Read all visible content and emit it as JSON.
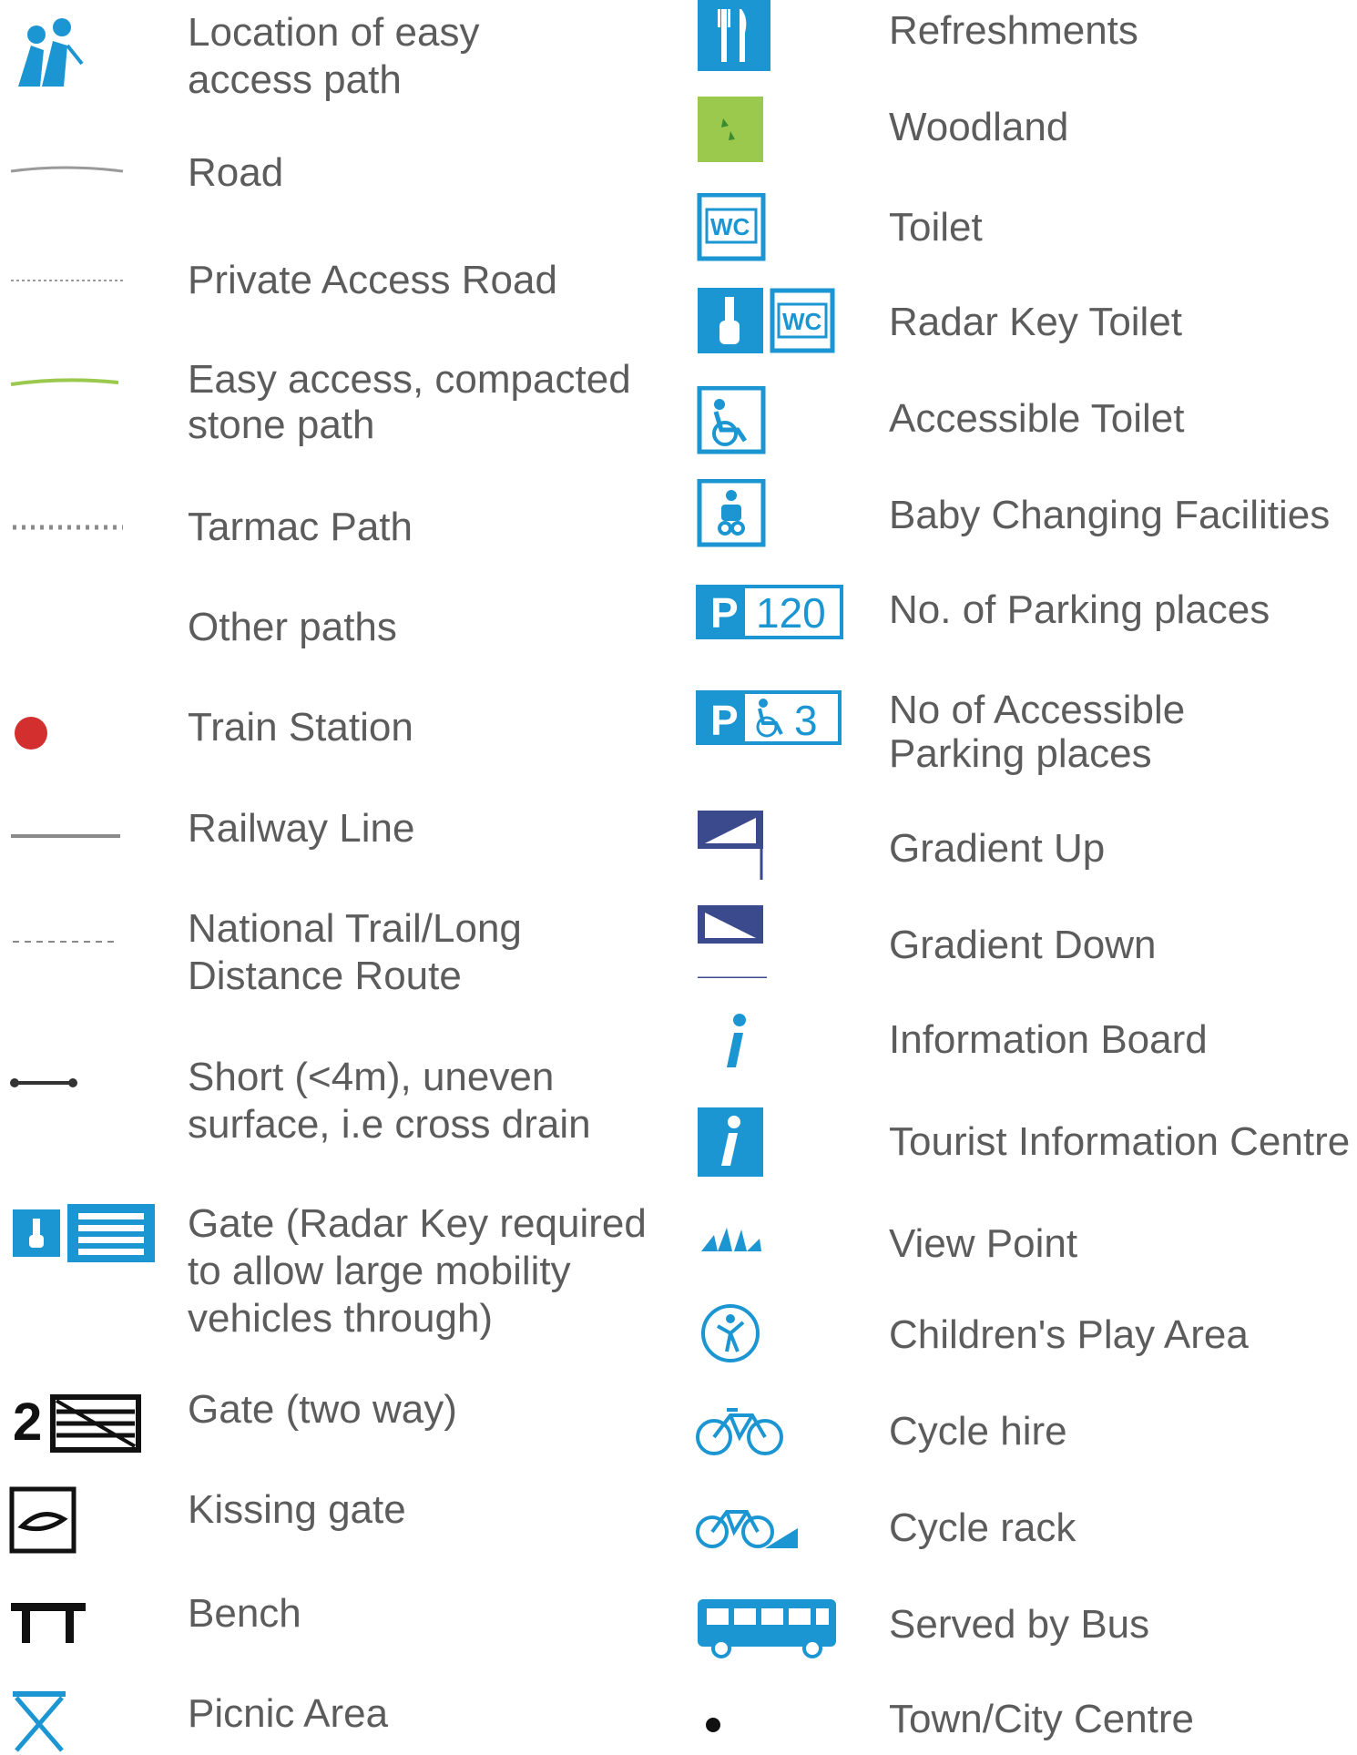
{
  "legend": {
    "left": [
      {
        "icon": "easy-access-walkers-icon",
        "label": "Location of easy\naccess path"
      },
      {
        "icon": "road-line-icon",
        "label": "Road"
      },
      {
        "icon": "private-road-dotted-icon",
        "label": "Private Access Road"
      },
      {
        "icon": "green-path-line-icon",
        "label": "Easy access, compacted\nstone path"
      },
      {
        "icon": "tarmac-path-icon",
        "label": "Tarmac Path"
      },
      {
        "icon": "dashed-path-icon",
        "label": "Other paths"
      },
      {
        "icon": "red-dot-icon",
        "label": "Train Station"
      },
      {
        "icon": "railway-line-icon",
        "label": "Railway Line"
      },
      {
        "icon": "national-trail-dashed-icon",
        "label": "National Trail/Long\nDistance Route"
      },
      {
        "icon": "short-bar-icon",
        "label": "Short (<4m), uneven\nsurface, i.e cross drain"
      },
      {
        "icon": "radar-key-gate-icon",
        "label": "Gate (Radar Key required\nto allow large mobility\nvehicles through)"
      },
      {
        "icon": "two-way-gate-icon",
        "label": "Gate (two way)",
        "number": "2"
      },
      {
        "icon": "kissing-gate-icon",
        "label": "Kissing gate"
      },
      {
        "icon": "bench-icon",
        "label": "Bench"
      },
      {
        "icon": "picnic-table-icon",
        "label": "Picnic Area"
      }
    ],
    "right": [
      {
        "icon": "knife-fork-icon",
        "label": "Refreshments"
      },
      {
        "icon": "woodland-icon",
        "label": "Woodland"
      },
      {
        "icon": "wc-icon",
        "label": "Toilet",
        "badge": "WC"
      },
      {
        "icon": "radar-key-wc-icon",
        "label": "Radar Key Toilet",
        "badge": "WC"
      },
      {
        "icon": "accessible-wc-icon",
        "label": "Accessible Toilet"
      },
      {
        "icon": "baby-changing-icon",
        "label": "Baby Changing Facilities"
      },
      {
        "icon": "parking-icon",
        "label": "No. of Parking places",
        "p": "P",
        "count": "120"
      },
      {
        "icon": "accessible-parking-icon",
        "label": "No of Accessible\nParking places",
        "p": "P",
        "count": "3"
      },
      {
        "icon": "gradient-up-icon",
        "label": "Gradient Up"
      },
      {
        "icon": "gradient-down-icon",
        "label": "Gradient Down"
      },
      {
        "icon": "info-board-icon",
        "label": "Information Board"
      },
      {
        "icon": "tourist-info-icon",
        "label": "Tourist Information Centre"
      },
      {
        "icon": "view-point-icon",
        "label": "View Point"
      },
      {
        "icon": "play-area-icon",
        "label": "Children's Play Area"
      },
      {
        "icon": "bicycle-icon",
        "label": "Cycle hire"
      },
      {
        "icon": "cycle-rack-icon",
        "label": "Cycle rack"
      },
      {
        "icon": "bus-icon",
        "label": "Served by Bus"
      },
      {
        "icon": "black-dot-icon",
        "label": "Town/City Centre"
      }
    ]
  },
  "colors": {
    "blue": "#1b96d3",
    "green": "#9ac94e",
    "red": "#d32f2f",
    "text": "#5c5c5c"
  }
}
